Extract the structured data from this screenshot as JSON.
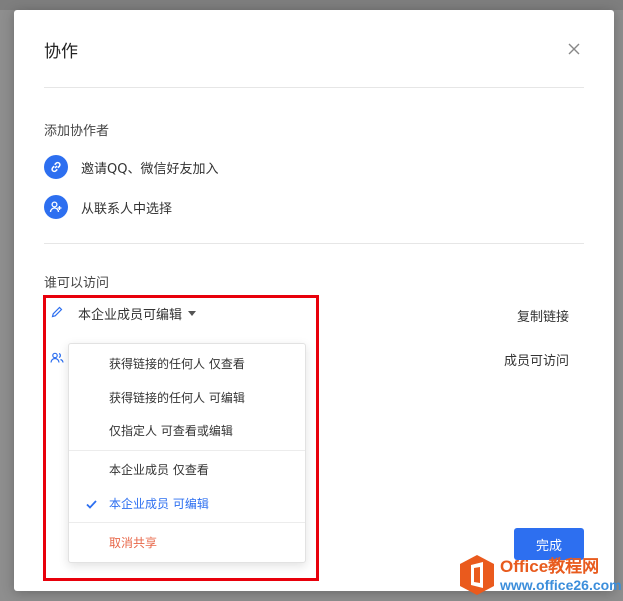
{
  "dialog": {
    "title": "协作",
    "add_section": {
      "label": "添加协作者",
      "invite_wechat": "邀请QQ、微信好友加入",
      "choose_contacts": "从联系人中选择"
    },
    "access_section": {
      "label": "谁可以访问",
      "current_permission": "本企业成员可编辑",
      "copy_link": "复制链接",
      "members_access": "成员可访问"
    },
    "done_button": "完成"
  },
  "dropdown": {
    "items": [
      {
        "label": "获得链接的任何人 仅查看"
      },
      {
        "label": "获得链接的任何人 可编辑"
      },
      {
        "label": "仅指定人 可查看或编辑"
      },
      {
        "label": "本企业成员 仅查看"
      },
      {
        "label": "本企业成员 可编辑",
        "selected": true
      },
      {
        "label": "取消共享",
        "danger": true
      }
    ]
  },
  "watermark": {
    "title": "Office教程网",
    "url": "www.office26.com"
  },
  "colors": {
    "accent": "#2d6ff0",
    "danger": "#e8684a",
    "highlight": "#e8000b"
  },
  "icons": [
    "close-icon",
    "link-icon",
    "add-user-icon",
    "pencil-icon",
    "members-icon",
    "checkmark-icon",
    "caret-down-icon"
  ]
}
